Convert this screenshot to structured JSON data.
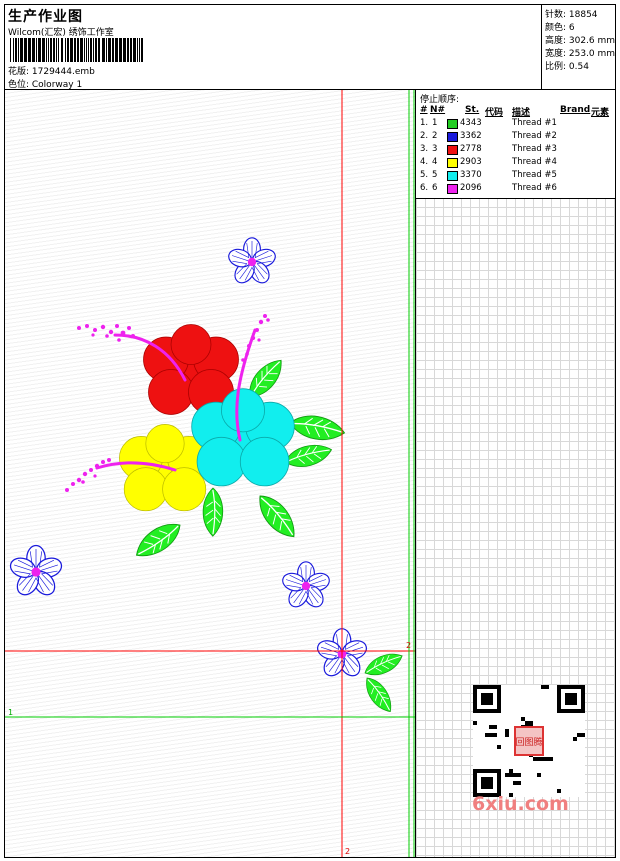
{
  "header": {
    "title": "生产作业图",
    "subtitle": "Wilcom(汇宏) 绣饰工作室",
    "design_line": "花版: 1729444.emb",
    "colorway_line": "色位: Colorway 1"
  },
  "stats": {
    "stitches": "针数: 18854",
    "colors": "颜色: 6",
    "height": "高度: 302.6 mm",
    "width": "宽度: 253.0 mm",
    "scale": "比例: 0.54"
  },
  "threads": {
    "title": "停止顺序:",
    "headers": {
      "num": "#",
      "n": "N#",
      "st": "St.",
      "code": "代码",
      "desc": "描述",
      "brand": "Brand",
      "elem": "元素"
    },
    "rows": [
      {
        "num": "1.",
        "n": "1",
        "code": "4343",
        "desc": "Thread #1",
        "color": "#22cc22"
      },
      {
        "num": "2.",
        "n": "2",
        "code": "3362",
        "desc": "Thread #2",
        "color": "#1a1adc"
      },
      {
        "num": "3.",
        "n": "3",
        "code": "2778",
        "desc": "Thread #3",
        "color": "#ee1111"
      },
      {
        "num": "4.",
        "n": "4",
        "code": "2903",
        "desc": "Thread #4",
        "color": "#ffff00"
      },
      {
        "num": "5.",
        "n": "5",
        "code": "3370",
        "desc": "Thread #5",
        "color": "#11eeee"
      },
      {
        "num": "6.",
        "n": "6",
        "code": "2096",
        "desc": "Thread #6",
        "color": "#ee22ee"
      }
    ]
  },
  "guides": {
    "green_label_left": "1",
    "red_label_right": "2",
    "red_label_bottom": "2",
    "red_color": "#ff0000",
    "green_color": "#00cc00"
  },
  "watermark": {
    "text": "6xiu.com",
    "seal_text": "回图腾"
  }
}
